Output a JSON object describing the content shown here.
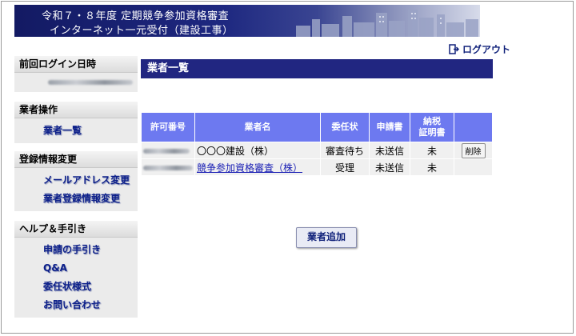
{
  "banner": {
    "line1": "令和７・８年度 定期競争参加資格審査",
    "line2": "インターネット一元受付（建設工事）"
  },
  "logout_label": "ログアウト",
  "sidebar": {
    "last_login": {
      "heading": "前回ログイン日時"
    },
    "operations": {
      "heading": "業者操作",
      "items": [
        "業者一覧"
      ]
    },
    "registration": {
      "heading": "登録情報変更",
      "items": [
        "メールアドレス変更",
        "業者登録情報変更"
      ]
    },
    "help": {
      "heading": "ヘルプ＆手引き",
      "items": [
        "申請の手引き",
        "Q&A",
        "委任状様式",
        "お問い合わせ"
      ]
    }
  },
  "main": {
    "title": "業者一覧",
    "table": {
      "headers": [
        "許可番号",
        "業者名",
        "委任状",
        "申請書",
        "納税\n証明書",
        ""
      ],
      "rows": [
        {
          "company": "〇〇〇建設（株）",
          "proxy": "審査待ち",
          "application": "未送信",
          "tax": "未",
          "action": "削除"
        },
        {
          "company": "競争参加資格審査（株）",
          "proxy": "受理",
          "application": "未送信",
          "tax": "未",
          "action": ""
        }
      ]
    },
    "add_button": "業者追加"
  },
  "colors": {
    "header_navy": "#212681",
    "table_header": "#6d79f0",
    "link": "#0c1f8a"
  }
}
